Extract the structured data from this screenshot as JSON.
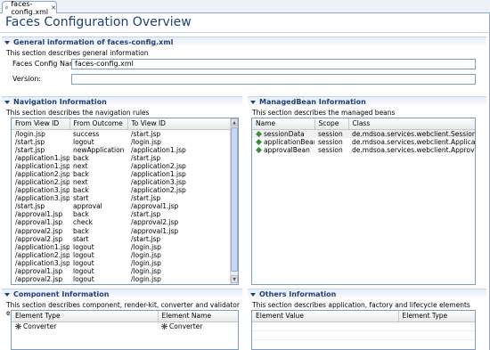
{
  "tab": {
    "label": "faces-config.xml",
    "close": "✕"
  },
  "page_title": "Faces Configuration Overview",
  "general": {
    "title": "General information of faces-config.xml",
    "desc": "This section describes general information",
    "config_name_label": "Faces Config Name:",
    "config_name_value": "faces-config.xml",
    "version_label": "Version:",
    "version_value": ""
  },
  "navigation": {
    "title": "Navigation Information",
    "desc": "This section describes the navigation rules",
    "columns": [
      "From View ID",
      "From Outcome",
      "To View ID"
    ],
    "rows": [
      [
        "/login.jsp",
        "success",
        "/start.jsp"
      ],
      [
        "/start.jsp",
        "logout",
        "/login.jsp"
      ],
      [
        "/start.jsp",
        "newApplication",
        "/application1.jsp"
      ],
      [
        "/application1.jsp",
        "back",
        "/start.jsp"
      ],
      [
        "/application1.jsp",
        "next",
        "/application2.jsp"
      ],
      [
        "/application2.jsp",
        "back",
        "/application1.jsp"
      ],
      [
        "/application2.jsp",
        "next",
        "/application3.jsp"
      ],
      [
        "/application3.jsp",
        "back",
        "/application2.jsp"
      ],
      [
        "/application3.jsp",
        "start",
        "/start.jsp"
      ],
      [
        "/start.jsp",
        "approval",
        "/approval1.jsp"
      ],
      [
        "/approval1.jsp",
        "back",
        "/start.jsp"
      ],
      [
        "/approval1.jsp",
        "check",
        "/approval2.jsp"
      ],
      [
        "/approval2.jsp",
        "back",
        "/approval1.jsp"
      ],
      [
        "/approval2.jsp",
        "start",
        "/start.jsp"
      ],
      [
        "/application1.jsp",
        "logout",
        "/login.jsp"
      ],
      [
        "/application2.jsp",
        "logout",
        "/login.jsp"
      ],
      [
        "/application3.jsp",
        "logout",
        "/login.jsp"
      ],
      [
        "/approval1.jsp",
        "logout",
        "/login.jsp"
      ],
      [
        "/approval2.jsp",
        "logout",
        "/login.jsp"
      ]
    ]
  },
  "managed_beans": {
    "title": "ManagedBean Information",
    "desc": "This section describes the managed beans",
    "columns": [
      "Name",
      "Scope",
      "Class"
    ],
    "rows": [
      [
        "sessionData",
        "session",
        "de.mdsoa.services.webclient.SessionData"
      ],
      [
        "applicationBean",
        "session",
        "de.mdsoa.services.webclient.Applicatio..."
      ],
      [
        "approvalBean",
        "session",
        "de.mdsoa.services.webclient.Approval..."
      ]
    ]
  },
  "components": {
    "title": "Component Information",
    "desc": "This section describes component, render-kit, converter and validator elements",
    "columns": [
      "Element Type",
      "Element Name"
    ],
    "rows": [
      [
        "Converter",
        "Converter"
      ]
    ]
  },
  "others": {
    "title": "Others Information",
    "desc": "This section describes application, factory and lifecycle elements",
    "columns": [
      "Element Value",
      "Element Type"
    ],
    "rows": []
  },
  "colors": {
    "title_blue": "#1f3f78",
    "border_blue": "#7f9db9",
    "bean_green": "#3c8a3c"
  }
}
